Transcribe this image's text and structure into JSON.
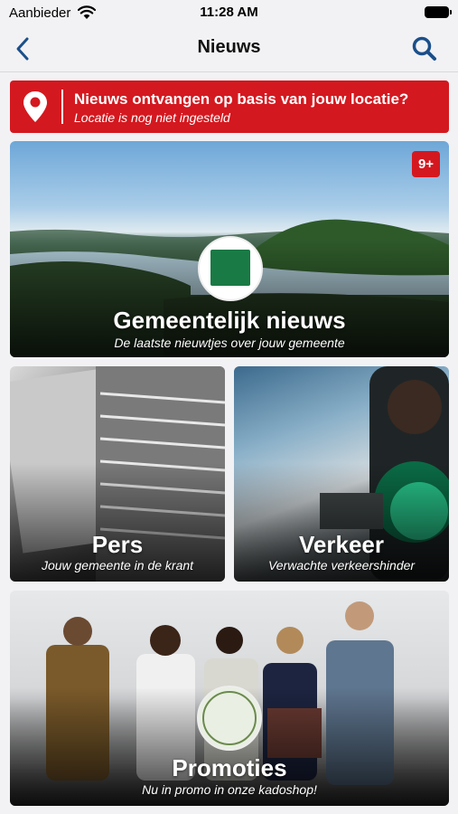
{
  "status_bar": {
    "carrier": "Aanbieder",
    "time": "11:28 AM"
  },
  "nav": {
    "title": "Nieuws",
    "back_icon": "chevron-left-icon",
    "search_icon": "search-icon",
    "accent_color": "#1b4f8a"
  },
  "location_banner": {
    "title": "Nieuws ontvangen op basis van jouw locatie?",
    "subtitle": "Locatie is nog niet ingesteld",
    "icon": "map-pin-icon",
    "color": "#d4181f"
  },
  "cards": {
    "gemeente": {
      "title": "Gemeentelijk nieuws",
      "subtitle": "De laatste nieuwtjes over jouw gemeente",
      "badge": "9+"
    },
    "pers": {
      "title": "Pers",
      "subtitle": "Jouw gemeente in de krant"
    },
    "verkeer": {
      "title": "Verkeer",
      "subtitle": "Verwachte verkeershinder"
    },
    "promo": {
      "title": "Promoties",
      "subtitle": "Nu in promo in onze kadoshop!"
    }
  }
}
